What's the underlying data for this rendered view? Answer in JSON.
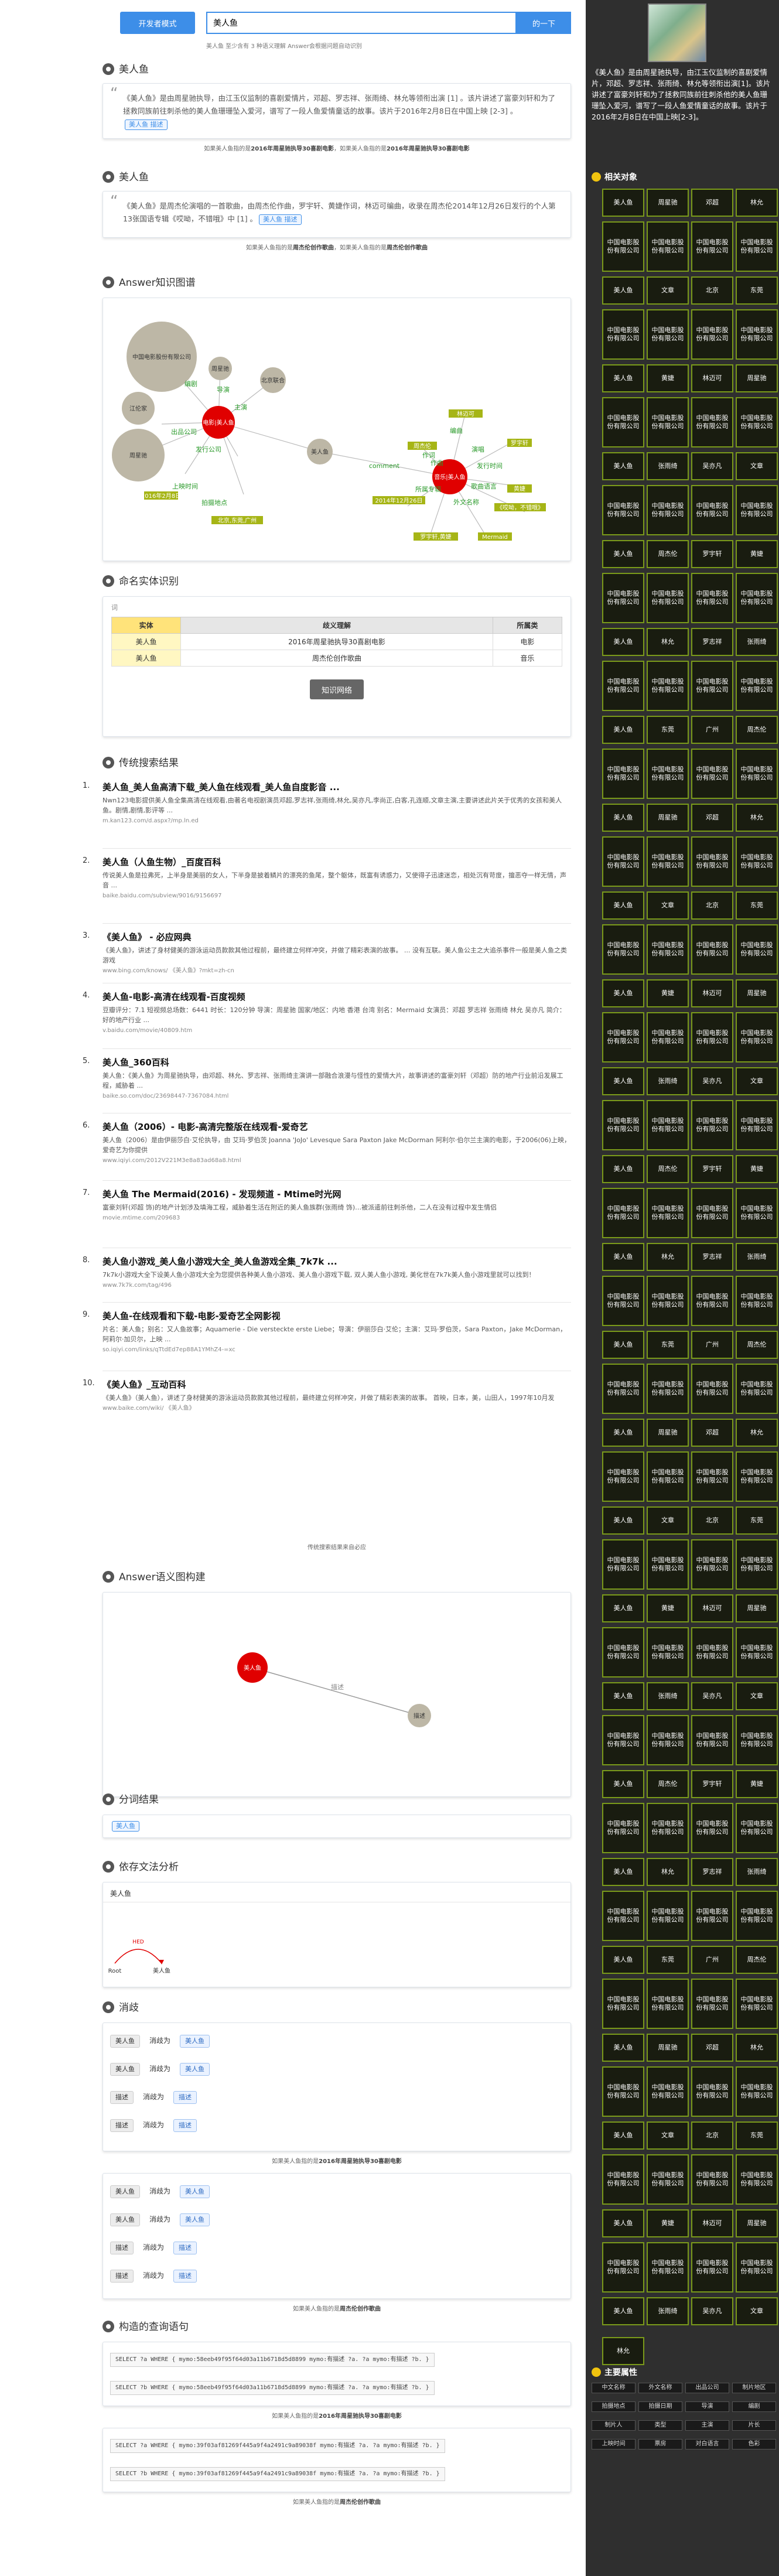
{
  "header": {
    "dev_mode_label": "开发者模式",
    "search_value": "美人鱼",
    "search_button": "的一下",
    "hint": "美人鱼  至少含有 3 种语义理解 Answer会根据问题自动识别"
  },
  "meaning1": {
    "title": "美人鱼",
    "text": "《美人鱼》是由周星驰执导，由江玉仪监制的喜剧爱情片，邓超、罗志祥、张雨绮、林允等领衔出演 [1] 。该片讲述了富豪刘轩和为了拯救同族前往刺杀他的美人鱼珊珊坠入爱河，谱写了一段人鱼爱情童话的故事。该片于2016年2月8日在中国上映 [2-3] 。",
    "tag": "美人鱼 描述",
    "source_prefix": "如果美人鱼指的是",
    "source_bold": "2016年周星驰执导30喜剧电影",
    "source_mid": "，如果美人鱼指的是",
    "source_bold2": "2016年周星驰执导30喜剧电影"
  },
  "meaning2": {
    "title": "美人鱼",
    "text": "《美人鱼》是周杰伦演唱的一首歌曲，由周杰伦作曲，罗宇轩、黄婕作词，林迈可编曲，收录在周杰伦2014年12月26日发行的个人第13张国语专辑《哎呦，不错哦》中 [1] 。",
    "tag": "美人鱼 描述",
    "source_prefix": "如果美人鱼指的是",
    "source_bold": "周杰伦创作歌曲",
    "source_mid": "，如果美人鱼指的是",
    "source_bold2": "周杰伦创作歌曲"
  },
  "knowledge_graph": {
    "title": "Answer知识图谱",
    "left_nodes": [
      "中国电影股份有限公司",
      "周星驰",
      "江伦家",
      "北京联合",
      "周星驰",
      "邓超",
      "2016年2月8日",
      "北京,东莞,广州",
      "上映时间",
      "拍摄地点",
      "编剧",
      "导演",
      "主演",
      "出品公司",
      "发行公司",
      "美人鱼"
    ],
    "center_node": "美人鱼",
    "left_center": "电影|美人鱼",
    "right_center": "音乐|美人鱼",
    "edge_comment": "comment",
    "right_nodes": [
      "林迈可",
      "周杰伦",
      "罗宇轩",
      "黄婕",
      "2014年12月26日",
      "《哎呦，不错哦》",
      "Mermaid",
      "罗宇轩,黄婕",
      "编曲",
      "作词",
      "作曲",
      "演唱",
      "发行时间",
      "所属专辑",
      "外文名称",
      "歌曲语言",
      "国语"
    ]
  },
  "ner": {
    "title": "命名实体识别",
    "mini_label": "词",
    "headers": [
      "实体",
      "歧义理解",
      "所属类"
    ],
    "rows": [
      [
        "美人鱼",
        "2016年周星驰执导30喜剧电影",
        "电影"
      ],
      [
        "美人鱼",
        "周杰伦创作歌曲",
        "音乐"
      ]
    ],
    "button": "知识网络"
  },
  "traditional": {
    "title": "传统搜索结果",
    "results": [
      {
        "n": "1.",
        "t": "美人鱼_美人鱼高清下载_美人鱼在线观看_美人鱼自度影音 ...",
        "d": "Nwn123电影提供美人鱼全集高清在线观看,由著名电视剧演员邓超,罗志祥,张雨绮,林允,吴亦凡,李尚正,白客,孔连顺,文章主演,主要讲述此片关于优秀的女孩和美人鱼。剧情,剧情,影评等 ...",
        "u": "m.kan123.com/d.aspx?/mp.ln.ed"
      },
      {
        "n": "2.",
        "t": "美人鱼（人鱼生物）_百度百科",
        "d": "传说美人鱼是拉弗死，上半身是美丽的女人，下半身是披着鳞片的漂亮的鱼尾，整个躯体，既富有诱惑力，又使得子迅速迷恋，相处沉有苛度，擅恶夺一样无情，声音 ...",
        "u": "baike.baidu.com/subview/9016/9156697"
      },
      {
        "n": "3.",
        "t": "《美人鱼》 - 必应网典",
        "d": "《美人鱼》，讲述了身材健美的游泳运动员款款其他过程前，最终建立何样冲突，并做了精彩表演的故事。 ...  没有互联。美人鱼公主之大追杀事件一般是美人鱼之类游戏",
        "u": "www.bing.com/knows/ 《美人鱼》?mkt=zh-cn"
      },
      {
        "n": "4.",
        "t": "美人鱼-电影-高清在线观看-百度视频",
        "d": "豆瓣评分：7.1 短视频总场数：6441 时长：120分钟 导演：周星驰 国家/地区：内地 香港 台湾 别名：Mermaid 女演员：邓超 罗志祥 张雨绮 林允 吴亦凡 简介：好的地产行业 ...",
        "u": "v.baidu.com/movie/40809.htm"
      },
      {
        "n": "5.",
        "t": "美人鱼_360百科",
        "d": "美人鱼：《美人鱼》为周星驰执导，由邓超、林允、罗志祥、张雨绮主演讲一部融合浪漫与怪性的爱情大片，故事讲述的富豪刘轩（邓超）防的地产行业前沿发展工程，威胁着 ...",
        "u": "baike.so.com/doc/23698447-7367084.html"
      },
      {
        "n": "6.",
        "t": "美人鱼（2006）- 电影-高清完整版在线观看-爱奇艺",
        "d": "美人鱼（2006）是由伊丽莎白·艾伦执导，由 艾玛·罗伯茨 Joanna 'JoJo' Levesque Sara Paxton Jake McDorman 阿利尔·伯尔兰主演的电影，于2006(06)上映，爱奇艺为你提供",
        "u": "www.iqiyi.com/2012V221M3e8a83ad68a8.html"
      },
      {
        "n": "7.",
        "t": "美人鱼 The Mermaid(2016) - 发现频道 - Mtime时光网",
        "d": "富豪刘轩(邓超 饰)的地产计划涉及填海工程，威胁着生活在附近的美人鱼族群(张雨绮 饰)…被派遣前往刺杀他，二人在没有过程中发生情侣",
        "u": "movie.mtime.com/209683"
      },
      {
        "n": "8.",
        "t": "美人鱼小游戏_美人鱼小游戏大全_美人鱼游戏全集_7k7k ...",
        "d": "7k7k小游戏大全下设美人鱼小游戏大全为您提供各种美人鱼小游戏、美人鱼小游戏下载, 双人美人鱼小游戏, 美化世在7k7k美人鱼小游戏里就可以找到！",
        "u": "www.7k7k.com/tag/496"
      },
      {
        "n": "9.",
        "t": "美人鱼-在线观看和下载-电影-爱奇艺全网影视",
        "d": "片名：美人鱼；别名：又人鱼故事；Aquamerie - Die versteckte erste Liebe；导演：伊丽莎白·艾伦；主演：艾玛·罗伯茨，Sara Paxton，Jake McDorman，阿莉尔·加贝尔，上映 ...",
        "u": "so.iqiyi.com/links/qTtdEd7ep88A1YMhZ4-=xc"
      },
      {
        "n": "10.",
        "t": "《美人鱼》_互动百科",
        "d": "《美人鱼》（美人鱼），讲述了身材健美的游泳运动员款款其他过程前，最终建立何样冲突，并做了精彩表演的故事。 首映，日本，美，山田人，1997年10月发",
        "u": "www.baike.com/wiki/ 《美人鱼》"
      }
    ],
    "source": "传统搜索结果来自必应"
  },
  "semantic_graph": {
    "title": "Answer语义图构建",
    "node_a": "美人鱼",
    "node_b": "描述",
    "edge": "描述"
  },
  "segmentation": {
    "title": "分词结果",
    "token": "美人鱼"
  },
  "dependency": {
    "title": "依存文法分析",
    "word": "美人鱼",
    "root": "Root",
    "arc_label": "HED"
  },
  "disambiguation": {
    "title": "消歧",
    "group1": [
      {
        "word": "美人鱼",
        "verb": "消歧为",
        "target": "美人鱼"
      },
      {
        "word": "美人鱼",
        "verb": "消歧为",
        "target": "美人鱼"
      },
      {
        "word": "描述",
        "verb": "消歧为",
        "target": "描述"
      },
      {
        "word": "描述",
        "verb": "消歧为",
        "target": "描述"
      }
    ],
    "source1_prefix": "如果美人鱼指的是",
    "source1_bold": "2016年周星驰执导30喜剧电影",
    "group2": [
      {
        "word": "美人鱼",
        "verb": "消歧为",
        "target": "美人鱼"
      },
      {
        "word": "美人鱼",
        "verb": "消歧为",
        "target": "美人鱼"
      },
      {
        "word": "描述",
        "verb": "消歧为",
        "target": "描述"
      },
      {
        "word": "描述",
        "verb": "消歧为",
        "target": "描述"
      }
    ],
    "source2_prefix": "如果美人鱼指的是",
    "source2_bold": "周杰伦创作歌曲"
  },
  "query": {
    "title": "构造的查询语句",
    "g1": [
      "SELECT ?a WHERE { mymo:58eeb49f95f64d03a11b6718d5d8899 mymo:有描述 ?a. ?a mymo:有描述 ?b. }",
      "SELECT ?b WHERE { mymo:58eeb49f95f64d03a11b6718d5d8899 mymo:有描述 ?a. ?a mymo:有描述 ?b. }"
    ],
    "source1_prefix": "如果美人鱼指的是",
    "source1_bold": "2016年周星驰执导30喜剧电影",
    "g2": [
      "SELECT ?a WHERE { mymo:39f03af81269f445a9f4a2491c9a89038f mymo:有描述 ?a. ?a mymo:有描述 ?b. }",
      "SELECT ?b WHERE { mymo:39f03af81269f445a9f4a2491c9a89038f mymo:有描述 ?a. ?a mymo:有描述 ?b. }"
    ],
    "source2_prefix": "如果美人鱼指的是",
    "source2_bold": "周杰伦创作歌曲"
  },
  "sidebar": {
    "summary": "《美人鱼》是由周星驰执导，由江玉仪监制的喜剧爱情片，邓超、罗志祥、张雨绮、林允等领衔出演[1]。该片讲述了富豪刘轩和为了拯救同族前往刺杀他的美人鱼珊珊坠入爱河，谱写了一段人鱼爱情童话的故事。该片于2016年2月8日在中国上映[2-3]。",
    "related_title": "相关对象",
    "short_tile": "美人鱼",
    "tall_tile": "中国电影股份有限公司",
    "small_tiles": [
      "周星驰",
      "邓超",
      "林允",
      "罗志祥",
      "张雨绮",
      "吴亦凡",
      "文章",
      "北京",
      "东莞",
      "广州",
      "周杰伦",
      "罗宇轩",
      "黄婕",
      "林迈可"
    ],
    "last_tile": "林允",
    "bottom_title": "主要属性",
    "relations": [
      "中文名称",
      "外文名称",
      "出品公司",
      "制片地区",
      "拍摄地点",
      "拍摄日期",
      "导演",
      "编剧",
      "制片人",
      "类型",
      "主演",
      "片长",
      "上映时间",
      "票房",
      "对白语言",
      "色彩"
    ]
  }
}
